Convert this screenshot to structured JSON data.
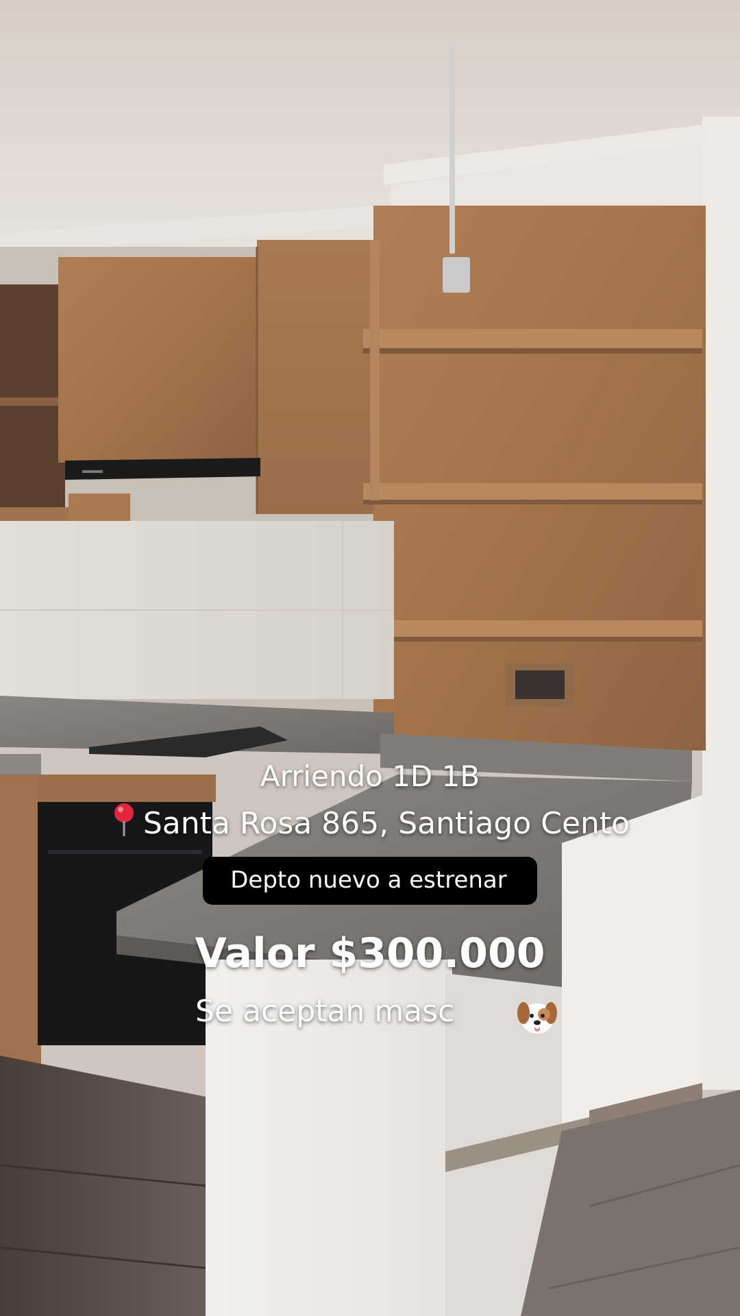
{
  "caption": {
    "title": "Arriendo 1D 1B",
    "address": "Santa Rosa 865, Santiago Cento",
    "pill": "Depto nuevo a estrenar",
    "price": "Valor $300.000",
    "pets": "Se aceptan masc"
  },
  "icons": {
    "pin": "round-pushpin-icon",
    "dog": "dog-face-icon"
  },
  "colors": {
    "wood": "#a3744c",
    "countertop": "#7c7a76",
    "wall": "#dcd8d2",
    "floor": "#5a4a42",
    "ceiling": "#ddd4cc"
  }
}
